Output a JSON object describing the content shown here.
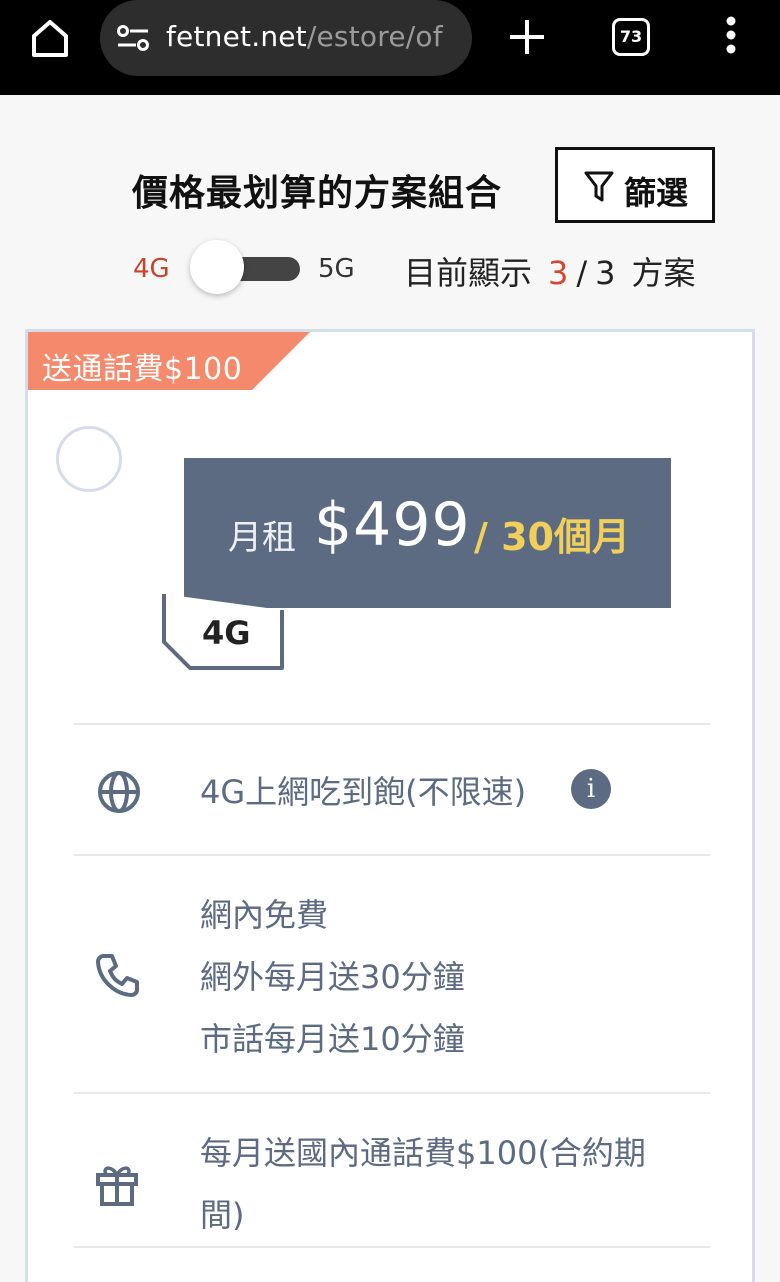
{
  "browser": {
    "url_host": "fetnet.net",
    "url_path": "/estore/of",
    "tab_count": "73"
  },
  "header": {
    "title": "價格最划算的方案組合",
    "filter_label": "篩選"
  },
  "network_toggle": {
    "left_label": "4G",
    "right_label": "5G",
    "selected": "4G"
  },
  "result_count": {
    "prefix": "目前顯示",
    "current": "3",
    "separator": "/",
    "total": "3",
    "unit": "方案"
  },
  "plan": {
    "promo_tag": "送通話費$100",
    "price_label": "月租",
    "price": "$499",
    "period": "/ 30個月",
    "network_badge": "4G",
    "features": [
      {
        "icon": "globe-icon",
        "lines": [
          "4G上網吃到飽(不限速)"
        ],
        "has_info": true,
        "info_symbol": "i"
      },
      {
        "icon": "phone-icon",
        "lines": [
          "網內免費",
          "網外每月送30分鐘",
          "市話每月送10分鐘"
        ]
      },
      {
        "icon": "gift-icon",
        "lines": [
          "每月送國內通話費$100(合約期",
          "間)"
        ]
      }
    ]
  },
  "colors": {
    "accent_red": "#d3482f",
    "promo": "#f5896b",
    "price_box": "#5c6b82",
    "price_period": "#f1cf5a"
  }
}
